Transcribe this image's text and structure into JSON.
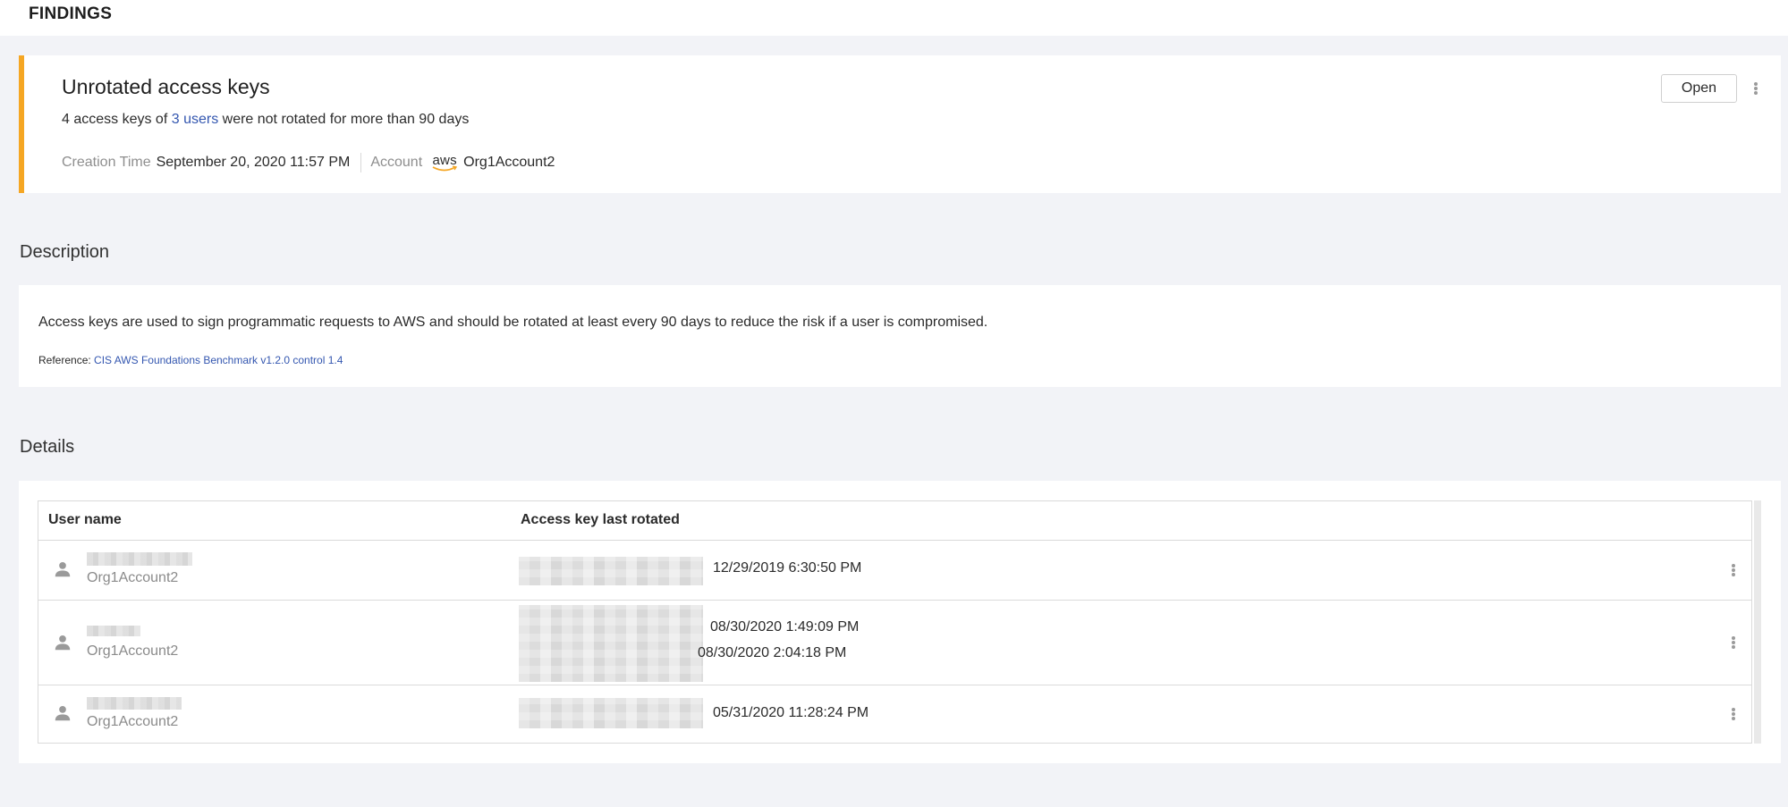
{
  "header": {
    "title": "FINDINGS"
  },
  "finding": {
    "title": "Unrotated access keys",
    "summary_prefix": "4 access keys of ",
    "summary_link": "3 users",
    "summary_suffix": " were not rotated for more than 90 days",
    "creation_time_label": "Creation Time",
    "creation_time_value": "September 20, 2020 11:57 PM",
    "account_label": "Account",
    "account_logo_text": "aws",
    "account_value": "Org1Account2",
    "status_button": "Open",
    "accent_color": "#f5a623"
  },
  "description": {
    "section_title": "Description",
    "text": "Access keys are used to sign programmatic requests to AWS and should be rotated at least every 90 days to reduce the risk if a user is compromised.",
    "reference_label": "Reference: ",
    "reference_link": "CIS AWS Foundations Benchmark v1.2.0 control 1.4"
  },
  "details": {
    "section_title": "Details",
    "columns": [
      "User name",
      "Access key last rotated"
    ],
    "rows": [
      {
        "account": "Org1Account2",
        "rotated": [
          "12/29/2019 6:30:50 PM"
        ]
      },
      {
        "account": "Org1Account2",
        "rotated": [
          "08/30/2020 1:49:09 PM",
          "08/30/2020 2:04:18 PM"
        ]
      },
      {
        "account": "Org1Account2",
        "rotated": [
          "05/31/2020 11:28:24 PM"
        ]
      }
    ]
  }
}
